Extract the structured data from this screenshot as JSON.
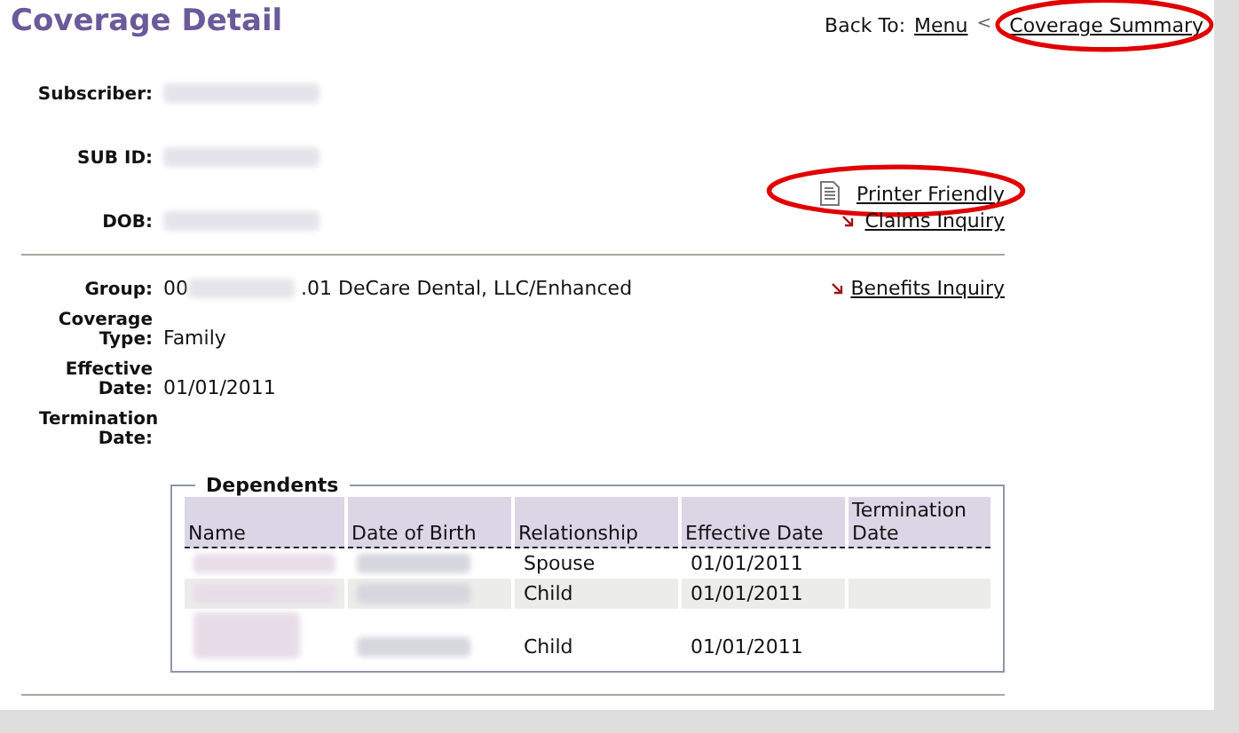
{
  "page": {
    "title": "Coverage Detail"
  },
  "back_to": {
    "label": "Back To:",
    "separator": "<",
    "links": [
      {
        "text": "Menu",
        "circled": false
      },
      {
        "text": "Coverage Summary",
        "circled": true
      }
    ]
  },
  "subscriber_fields": [
    {
      "label": "Subscriber:"
    },
    {
      "label": "SUB ID:"
    },
    {
      "label": "DOB:"
    }
  ],
  "actions": [
    {
      "text": "Printer Friendly",
      "kind": "document",
      "circled": true
    },
    {
      "text": "Claims Inquiry",
      "kind": "arrow",
      "circled": false
    }
  ],
  "coverage": {
    "link": "Benefits Inquiry",
    "fields": [
      {
        "label": "Group:",
        "value_prefix": "00",
        "value": ".01 DeCare Dental, LLC/Enhanced"
      },
      {
        "label": "Coverage Type:",
        "value": "Family"
      },
      {
        "label": "Effective Date:",
        "value": "01/01/2011"
      },
      {
        "label": "Termination Date:"
      }
    ]
  },
  "dependents": {
    "legend": "Dependents",
    "columns": [
      "Name",
      "Date of Birth",
      "Relationship",
      "Effective Date",
      "Termination Date"
    ],
    "rows": [
      {
        "relationship": "Spouse",
        "effective_date": "01/01/2011",
        "tall_name": false
      },
      {
        "relationship": "Child",
        "effective_date": "01/01/2011",
        "tall_name": false
      },
      {
        "relationship": "Child",
        "effective_date": "01/01/2011",
        "tall_name": true
      }
    ]
  }
}
